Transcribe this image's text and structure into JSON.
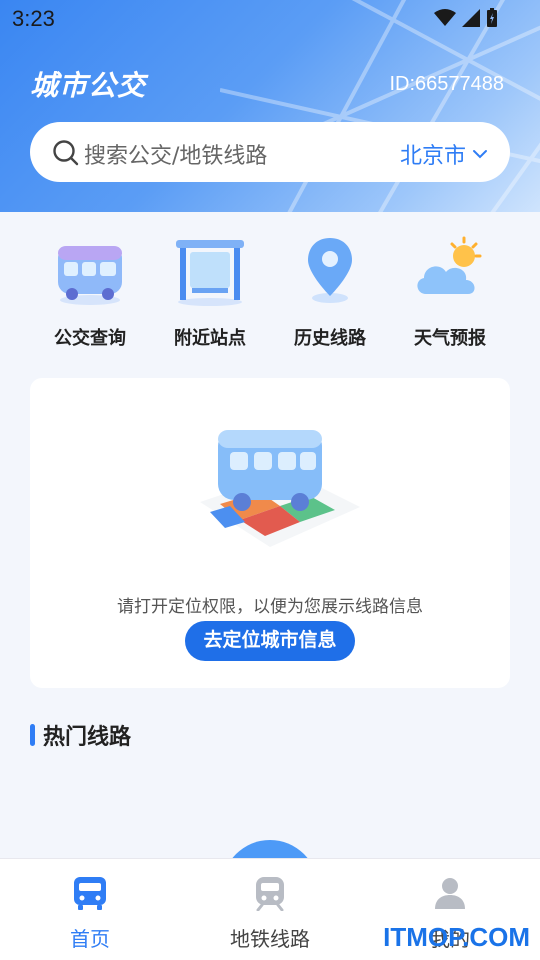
{
  "status_bar": {
    "time": "3:23"
  },
  "header": {
    "app_title": "城市公交",
    "user_id": "ID:66577488",
    "search": {
      "placeholder": "搜索公交/地铁线路",
      "city": "北京市"
    }
  },
  "quick_entries": [
    {
      "label": "公交查询",
      "icon": "bus-icon"
    },
    {
      "label": "附近站点",
      "icon": "bus-stop-icon"
    },
    {
      "label": "历史线路",
      "icon": "location-pin-icon"
    },
    {
      "label": "天气预报",
      "icon": "weather-icon"
    }
  ],
  "location_card": {
    "message": "请打开定位权限，以便为您展示线路信息",
    "button_label": "去定位城市信息"
  },
  "hot_lines": {
    "title": "热门线路"
  },
  "bottom_nav": [
    {
      "label": "首页",
      "active": true
    },
    {
      "label": "地铁线路",
      "active": false
    },
    {
      "label": "我的",
      "active": false
    }
  ],
  "watermark": "ITMOP.COM",
  "colors": {
    "accent": "#2f7df5",
    "button": "#1f6fe8"
  }
}
